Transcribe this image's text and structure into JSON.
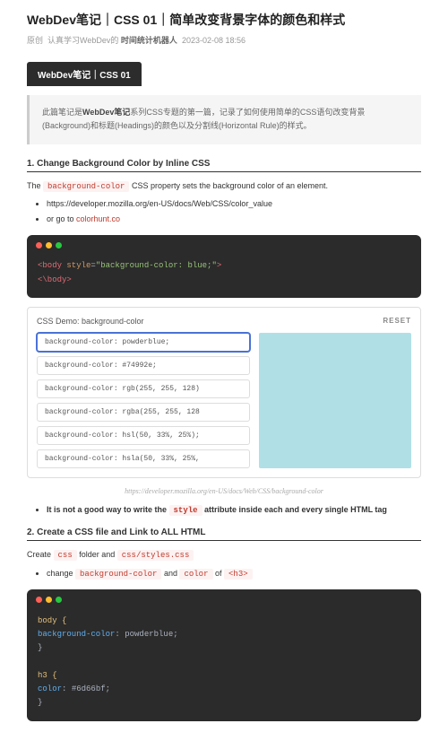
{
  "title": "WebDev笔记｜CSS 01｜简单改变背景字体的颜色和样式",
  "meta": {
    "cat": "原创",
    "pre": "认真学习WebDev的",
    "author": "时间统计机器人",
    "date": "2023-02-08 18:56"
  },
  "badge": "WebDev笔记｜CSS 01",
  "intro": {
    "a": "此篇笔记是",
    "b": "WebDev笔记",
    "c": "系列CSS专题的第一篇，记录了如何使用简单的CSS语句改变背景(Background)和标题(Headings)的颜色以及分割线(Horizontal Rule)的样式。"
  },
  "s1": {
    "h": "1. Change Background Color by Inline CSS",
    "p1a": "The ",
    "p1code": "background-color",
    "p1b": " CSS property sets the background color of an element.",
    "li1": "https://developer.mozilla.org/en-US/docs/Web/CSS/color_value",
    "li2a": "or go to ",
    "li2link": "colorhunt.co"
  },
  "code1": {
    "l1a": "<body ",
    "l1b": "style",
    "l1c": "=",
    "l1d": "\"background-color: blue;\"",
    "l1e": ">",
    "l2": "<\\body>"
  },
  "demo": {
    "title": "CSS Demo: background-color",
    "reset": "RESET",
    "opts": [
      "background-color: powderblue;",
      "background-color: #74992e;",
      "background-color: rgb(255, 255, 128)",
      "background-color: rgba(255, 255, 128",
      "background-color: hsl(50, 33%, 25%);",
      "background-color: hsla(50, 33%, 25%,"
    ]
  },
  "caption": "https://developer.mozilla.org/en-US/docs/Web/CSS/background-color",
  "warn": {
    "a": "It is not a good way to write the ",
    "code": "style",
    "b": " attribute inside each and every single HTML tag"
  },
  "s2": {
    "h": "2. Create a CSS file and Link to ALL HTML",
    "p1a": "Create ",
    "c1": "css",
    "p1b": " folder and ",
    "c2": "css/styles.css",
    "li1a": "change ",
    "lc1": "background-color",
    "li1b": " and ",
    "lc2": "color",
    "li1c": " of ",
    "lc3": "<h3>"
  },
  "code2": {
    "l1": "body {",
    "l2a": "  background-color",
    "l2b": ": powderblue;",
    "l3": "}",
    "l4": "",
    "l5": "h3 {",
    "l6a": "  color",
    "l6b": ": #6d66bf;",
    "l7": "}"
  }
}
